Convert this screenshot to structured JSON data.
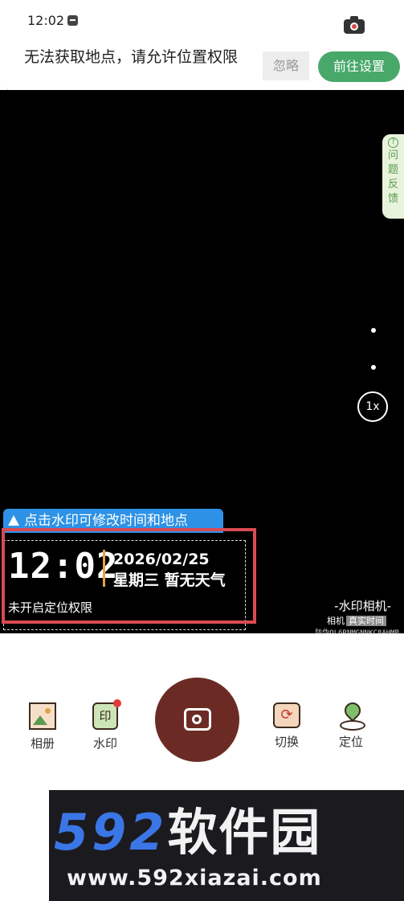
{
  "status_bar": {
    "time": "12:02"
  },
  "permission_banner": {
    "message": "无法获取地点，请允许位置权限",
    "ignore_label": "忽略",
    "settings_label": "前往设置"
  },
  "viewfinder": {
    "feedback_icon": "?",
    "feedback_label": "问题反馈",
    "zoom_label": "1x",
    "tip_text": "点击水印可修改时间和地点"
  },
  "watermark": {
    "time": "12:02",
    "date": "2026/02/25",
    "weekday_weather": "星期三 暂无天气",
    "location_status": "未开启定位权限"
  },
  "branding": {
    "title": "-水印相机-",
    "sub_label": "相机",
    "tag_label": "真实时间",
    "code": "防伪QL6RNMGNNKC8AHMB"
  },
  "toolbar": {
    "album_label": "相册",
    "watermark_label": "水印",
    "watermark_icon_char": "印",
    "switch_label": "切换",
    "switch_icon_char": "⟳",
    "locate_label": "定位"
  },
  "site_watermark": {
    "logo_num": "592",
    "logo_cn": "软件园",
    "url": "www.592xiazai.com"
  },
  "colors": {
    "accent_green": "#47a86a",
    "shutter_brown": "#6b2b24",
    "tip_blue": "#2d92e6",
    "watermark_frame_red": "#d94b52",
    "divider_orange": "#e3a24a"
  }
}
